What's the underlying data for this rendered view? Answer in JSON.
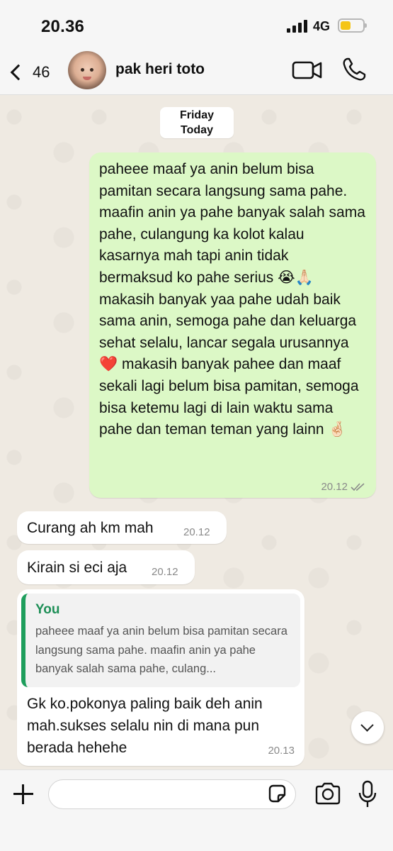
{
  "status_bar": {
    "time": "20.36",
    "network": "4G",
    "battery_level": 0.45,
    "battery_color": "#f5c518"
  },
  "header": {
    "back_count": "46",
    "contact_name": "pak heri toto",
    "icons": [
      "chevron-left-icon",
      "video-call-icon",
      "phone-icon"
    ]
  },
  "chat": {
    "date_pill": {
      "line1": "Friday",
      "line2": "Today"
    },
    "messages": [
      {
        "direction": "outgoing",
        "text": "paheee maaf ya anin belum bisa pamitan secara langsung sama pahe. maafin anin ya pahe banyak salah sama pahe, culangung ka kolot kalau kasarnya mah tapi anin tidak bermaksud ko pahe serius 😭🙏🏻 makasih banyak yaa pahe udah baik sama anin, semoga pahe dan keluarga sehat selalu, lancar segala urusannya ❤️ makasih banyak pahee dan maaf sekali lagi belum bisa pamitan, semoga bisa ketemu lagi di lain waktu sama pahe dan teman teman yang lainn 🤞🏻",
        "time": "20.12",
        "status": "read"
      },
      {
        "direction": "incoming",
        "text": "Curang ah km mah",
        "time": "20.12"
      },
      {
        "direction": "incoming",
        "text": "Kirain si eci aja",
        "time": "20.12"
      },
      {
        "direction": "incoming",
        "quote_author": "You",
        "quote_text": "paheee maaf ya anin belum bisa pamitan secara langsung sama pahe. maafin anin ya pahe banyak salah sama pahe, culang...",
        "text": "Gk ko.pokonya paling baik deh anin mah.sukses selalu nin di mana pun berada hehehe",
        "time": "20.13"
      }
    ]
  },
  "composer": {
    "input_value": "",
    "icons": [
      "plus-icon",
      "sticker-icon",
      "camera-icon",
      "microphone-icon"
    ]
  },
  "colors": {
    "outgoing_bubble": "#dcf8c6",
    "incoming_bubble": "#ffffff",
    "chat_background": "#efeae2",
    "quote_accent": "#1e9e5c"
  }
}
